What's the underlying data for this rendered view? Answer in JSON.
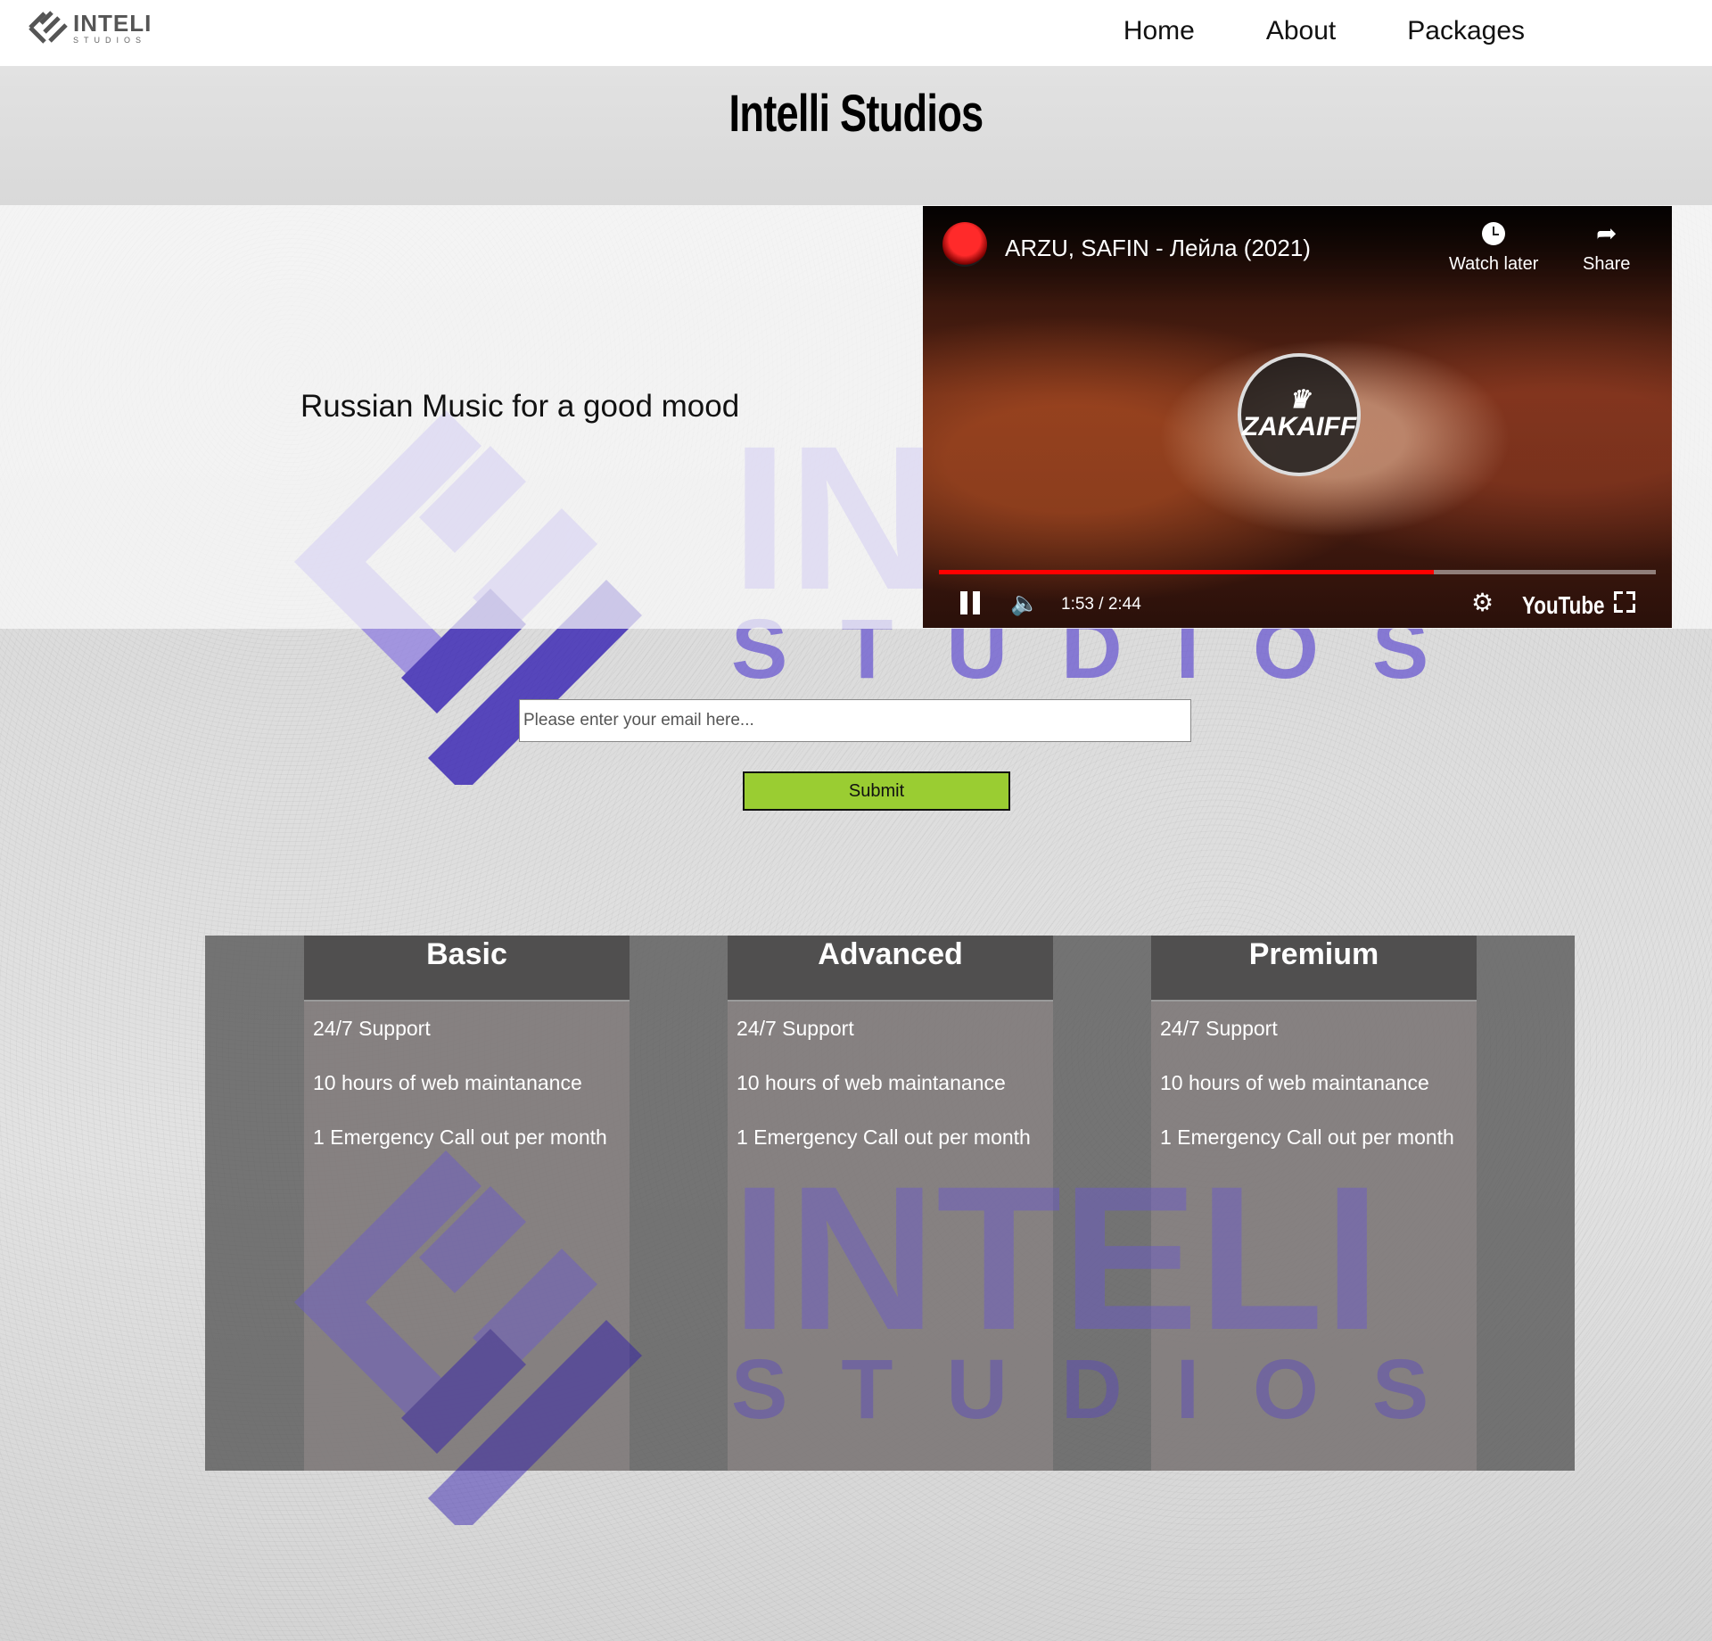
{
  "header": {
    "logo": {
      "main": "INTELI",
      "sub": "STUDIOS"
    },
    "nav": [
      {
        "label": "Home"
      },
      {
        "label": "About"
      },
      {
        "label": "Packages"
      }
    ]
  },
  "hero": {
    "title": "Intelli Studios",
    "tagline": "Russian Music for a good mood"
  },
  "video": {
    "title": "ARZU, SAFIN - Лейла (2021)",
    "watch_later_label": "Watch later",
    "share_label": "Share",
    "time": "1:53 / 2:44",
    "progress": 0.69,
    "brand": "YouTube",
    "channel_badge": "ZAKAIFF"
  },
  "form": {
    "email_placeholder": "Please enter your email here...",
    "email_value": "",
    "submit_label": "Submit"
  },
  "watermark": {
    "main": "INTELI",
    "sub": "STUDIOS"
  },
  "packages": [
    {
      "name": "Basic",
      "features": [
        "24/7 Support",
        "10 hours of web maintanance",
        "1 Emergency Call out per month"
      ]
    },
    {
      "name": "Advanced",
      "features": [
        "24/7 Support",
        "10 hours of web maintanance",
        "1 Emergency Call out per month"
      ]
    },
    {
      "name": "Premium",
      "features": [
        "24/7 Support",
        "10 hours of web maintanance",
        "1 Emergency Call out per month"
      ]
    }
  ],
  "colors": {
    "submit_button": "#9acd32",
    "watermark_purple": "#8f7ee0",
    "watermark_dark": "#2a14b0",
    "video_progress": "#ff0000"
  }
}
